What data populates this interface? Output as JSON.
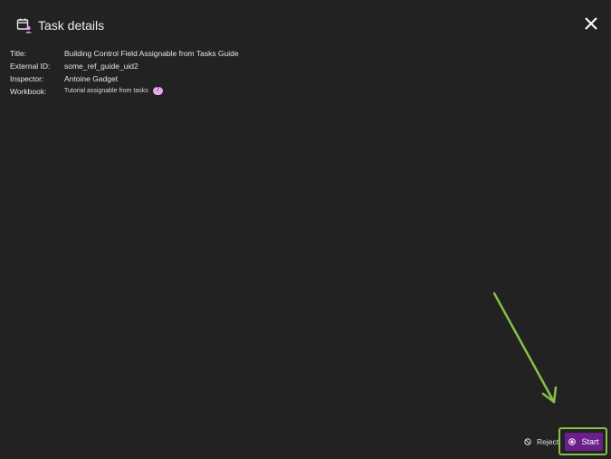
{
  "header": {
    "title": "Task details",
    "icon": "calendar-user-icon",
    "close_icon": "close-icon"
  },
  "details": {
    "rows": [
      {
        "label": "Title:",
        "value": "Building Control Field Assignable from Tasks Guide"
      },
      {
        "label": "External ID:",
        "value": "some_ref_guide_uid2"
      },
      {
        "label": "Inspector:",
        "value": "Antoine Gadget"
      },
      {
        "label": "Workbook:",
        "value": "Tutorial assignable from tasks",
        "badge": "7"
      }
    ]
  },
  "actions": {
    "reject_label": "Reject",
    "reject_icon": "block-icon",
    "start_label": "Start",
    "start_icon": "record-icon"
  },
  "colors": {
    "background": "#222222",
    "primary": "#6a1f8a",
    "annotation": "#86c04a",
    "badge": "#e8a8f0"
  }
}
